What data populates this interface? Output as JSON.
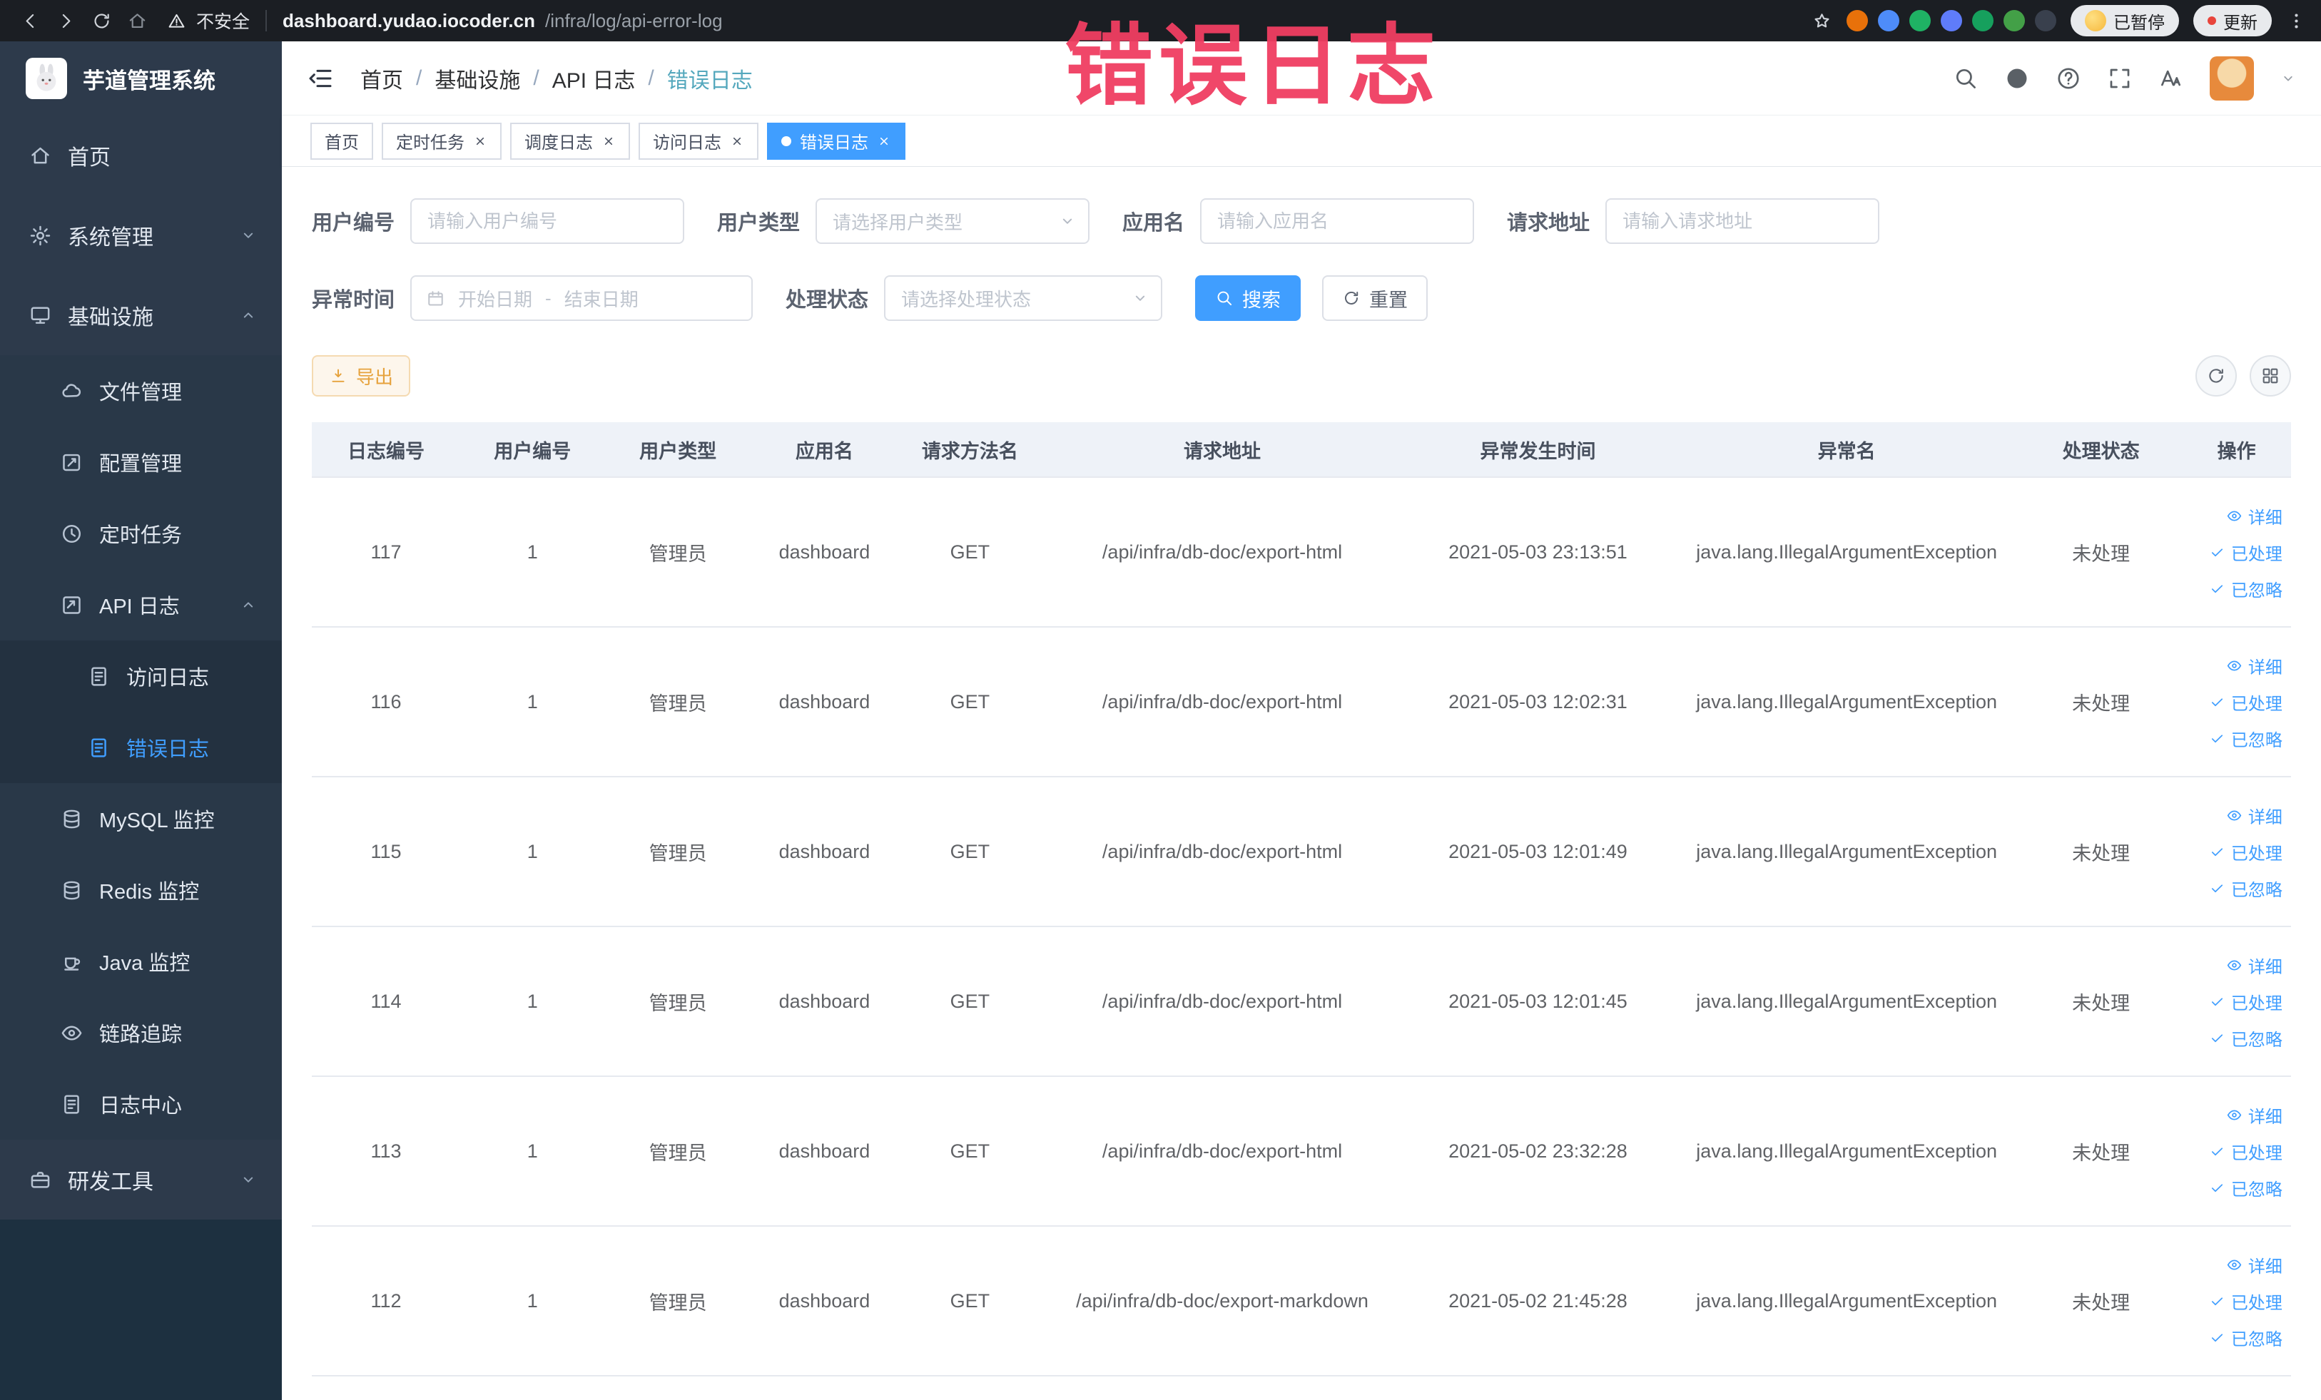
{
  "colors": {
    "accent": "#409eff",
    "warning": "#e6a23c",
    "annotation": "#f03e62",
    "sidebar_bg": "#2d3a4b"
  },
  "browser": {
    "security_label": "不安全",
    "url_host": "dashboard.yudao.iocoder.cn",
    "url_path": "/infra/log/api-error-log",
    "paused_badge": "已暂停",
    "update_label": "更新",
    "extensions": [
      {
        "name": "extension-orange",
        "color": "#e8710a"
      },
      {
        "name": "extension-blue-drop",
        "color": "#4e8cf9"
      },
      {
        "name": "extension-green",
        "color": "#1fb264"
      },
      {
        "name": "extension-grid",
        "color": "#5f7cfa"
      },
      {
        "name": "extension-on-badge",
        "color": "#16a05d"
      },
      {
        "name": "extension-leaf",
        "color": "#43a047"
      },
      {
        "name": "extension-paw",
        "color": "#39404d"
      }
    ]
  },
  "sidebar": {
    "logo_title": "芋道管理系统",
    "items": [
      {
        "key": "home",
        "label": "首页",
        "icon": "home",
        "level": 1
      },
      {
        "key": "system",
        "label": "系统管理",
        "icon": "gear",
        "level": 1,
        "chevron": "down"
      },
      {
        "key": "infra",
        "label": "基础设施",
        "icon": "monitor",
        "level": 1,
        "chevron": "up"
      },
      {
        "key": "file",
        "label": "文件管理",
        "icon": "cloud",
        "level": 2
      },
      {
        "key": "config",
        "label": "配置管理",
        "icon": "edit",
        "level": 2
      },
      {
        "key": "job",
        "label": "定时任务",
        "icon": "timer",
        "level": 2
      },
      {
        "key": "api-log",
        "label": "API 日志",
        "icon": "apilog",
        "level": 2,
        "chevron": "up"
      },
      {
        "key": "access-log",
        "label": "访问日志",
        "icon": "doc",
        "level": 3
      },
      {
        "key": "error-log",
        "label": "错误日志",
        "icon": "doc",
        "level": 3,
        "active": true
      },
      {
        "key": "mysql",
        "label": "MySQL 监控",
        "icon": "db",
        "level": 2
      },
      {
        "key": "redis",
        "label": "Redis 监控",
        "icon": "db",
        "level": 2
      },
      {
        "key": "java",
        "label": "Java 监控",
        "icon": "java",
        "level": 2
      },
      {
        "key": "trace",
        "label": "链路追踪",
        "icon": "eye",
        "level": 2
      },
      {
        "key": "log-center",
        "label": "日志中心",
        "icon": "doc",
        "level": 2
      },
      {
        "key": "dev-tools",
        "label": "研发工具",
        "icon": "briefcase",
        "level": 1,
        "chevron": "down"
      }
    ]
  },
  "header": {
    "breadcrumbs": [
      "首页",
      "基础设施",
      "API 日志",
      "错误日志"
    ],
    "breadcrumb_separator": "/"
  },
  "annotation": "错误日志",
  "tabs": [
    {
      "label": "首页",
      "closable": false,
      "active": false
    },
    {
      "label": "定时任务",
      "closable": true,
      "active": false
    },
    {
      "label": "调度日志",
      "closable": true,
      "active": false
    },
    {
      "label": "访问日志",
      "closable": true,
      "active": false
    },
    {
      "label": "错误日志",
      "closable": true,
      "active": true
    }
  ],
  "filters": {
    "user_id": {
      "label": "用户编号",
      "placeholder": "请输入用户编号"
    },
    "user_type": {
      "label": "用户类型",
      "placeholder": "请选择用户类型"
    },
    "app_name": {
      "label": "应用名",
      "placeholder": "请输入应用名"
    },
    "request_url": {
      "label": "请求地址",
      "placeholder": "请输入请求地址"
    },
    "exception_time": {
      "label": "异常时间",
      "start_placeholder": "开始日期",
      "separator": "-",
      "end_placeholder": "结束日期"
    },
    "process_status": {
      "label": "处理状态",
      "placeholder": "请选择处理状态"
    },
    "search_label": "搜索",
    "reset_label": "重置"
  },
  "toolbar": {
    "export_label": "导出"
  },
  "table": {
    "columns": [
      "日志编号",
      "用户编号",
      "用户类型",
      "应用名",
      "请求方法名",
      "请求地址",
      "异常发生时间",
      "异常名",
      "处理状态",
      "操作"
    ],
    "action_labels": [
      "详细",
      "已处理",
      "已忽略"
    ],
    "rows": [
      {
        "log_id": "117",
        "user_id": "1",
        "user_type": "管理员",
        "app_name": "dashboard",
        "method": "GET",
        "url": "/api/infra/db-doc/export-html",
        "time": "2021-05-03 23:13:51",
        "exception": "java.lang.IllegalArgumentException",
        "status": "未处理"
      },
      {
        "log_id": "116",
        "user_id": "1",
        "user_type": "管理员",
        "app_name": "dashboard",
        "method": "GET",
        "url": "/api/infra/db-doc/export-html",
        "time": "2021-05-03 12:02:31",
        "exception": "java.lang.IllegalArgumentException",
        "status": "未处理"
      },
      {
        "log_id": "115",
        "user_id": "1",
        "user_type": "管理员",
        "app_name": "dashboard",
        "method": "GET",
        "url": "/api/infra/db-doc/export-html",
        "time": "2021-05-03 12:01:49",
        "exception": "java.lang.IllegalArgumentException",
        "status": "未处理"
      },
      {
        "log_id": "114",
        "user_id": "1",
        "user_type": "管理员",
        "app_name": "dashboard",
        "method": "GET",
        "url": "/api/infra/db-doc/export-html",
        "time": "2021-05-03 12:01:45",
        "exception": "java.lang.IllegalArgumentException",
        "status": "未处理"
      },
      {
        "log_id": "113",
        "user_id": "1",
        "user_type": "管理员",
        "app_name": "dashboard",
        "method": "GET",
        "url": "/api/infra/db-doc/export-html",
        "time": "2021-05-02 23:32:28",
        "exception": "java.lang.IllegalArgumentException",
        "status": "未处理"
      },
      {
        "log_id": "112",
        "user_id": "1",
        "user_type": "管理员",
        "app_name": "dashboard",
        "method": "GET",
        "url": "/api/infra/db-doc/export-markdown",
        "time": "2021-05-02 21:45:28",
        "exception": "java.lang.IllegalArgumentException",
        "status": "未处理"
      }
    ]
  }
}
